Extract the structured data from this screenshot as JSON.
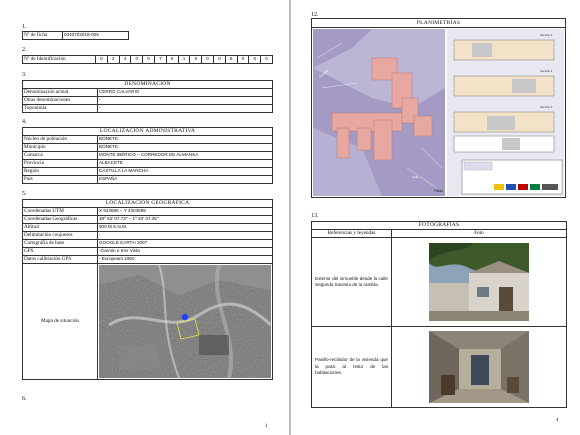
{
  "left": {
    "s1": {
      "num": "1.",
      "label": "Nº de ficha",
      "value": "0340702018-005"
    },
    "s2": {
      "num": "2.",
      "label": "Nº de Identificación",
      "digits": [
        "0",
        "3",
        "4",
        "0",
        "0",
        "7",
        "0",
        "1",
        "8",
        "0",
        "0",
        "5",
        "0",
        "0",
        "0"
      ]
    },
    "s3": {
      "num": "3.",
      "title": "DENOMINACIÓN",
      "rows": [
        {
          "label": "Denominación actual",
          "value": "CERRO CALVARIO"
        },
        {
          "label": "Otras denominaciones",
          "value": "-"
        },
        {
          "label": "Toponimia",
          "value": "-"
        }
      ]
    },
    "s4": {
      "num": "4.",
      "title": "LOCALIZACIÓN ADMINISTRATIVA",
      "rows": [
        {
          "label": "Núcleo de población",
          "value": "BONETE"
        },
        {
          "label": "Municipio",
          "value": "BONETE"
        },
        {
          "label": "Comarca",
          "value": "MONTE IBÉRICO – CORREDOR DE ALMANSA"
        },
        {
          "label": "Provincia",
          "value": "ALBACETE"
        },
        {
          "label": "Región",
          "value": "CASTILLA LA MANCHA"
        },
        {
          "label": "País",
          "value": "ESPAÑA"
        }
      ]
    },
    "s5": {
      "num": "5.",
      "title": "LOCALIZACIÓN GEOGRÁFICA",
      "rows": [
        {
          "label": "Coordenadas UTM",
          "value": "X 643696 – Y 4303595"
        },
        {
          "label": "Coordenadas Geográficas",
          "value": "38º 52' 07.73\" – 1º 20' 37.35\""
        },
        {
          "label": "Altitud",
          "value": "900 M S.N.M."
        },
        {
          "label": "Delimitación conjuntos",
          "value": "-"
        },
        {
          "label": "Cartografía de base",
          "value": "GOOGLE EARTH 2007"
        },
        {
          "label": "GPS",
          "value": "-Garmin e trex Vista"
        },
        {
          "label": "Datos calibración GPS",
          "value": "- Europeam 1950"
        }
      ],
      "map_label": "Mapa de situación"
    },
    "s6": {
      "num": "6."
    },
    "page_number": "1"
  },
  "right": {
    "s12": {
      "num": "12.",
      "title": "PLANIMETRÍAS"
    },
    "s13": {
      "num": "13.",
      "title": "FOTOGRAFÍAS",
      "col1": "Referencias y leyendas",
      "col2": "Foto",
      "rows": [
        {
          "caption": "Exterior del inmueble desde la calle Segunda travesía de la rambla."
        },
        {
          "caption": "Pasillo-recibidor de la vivienda que la paso al resto de las habitaciones."
        }
      ]
    },
    "page_number": "4"
  },
  "colors": {
    "plan_bg": "#a49ac4",
    "plan_building": "#e6a8a0",
    "sketch_bg": "#e8e8f0"
  }
}
